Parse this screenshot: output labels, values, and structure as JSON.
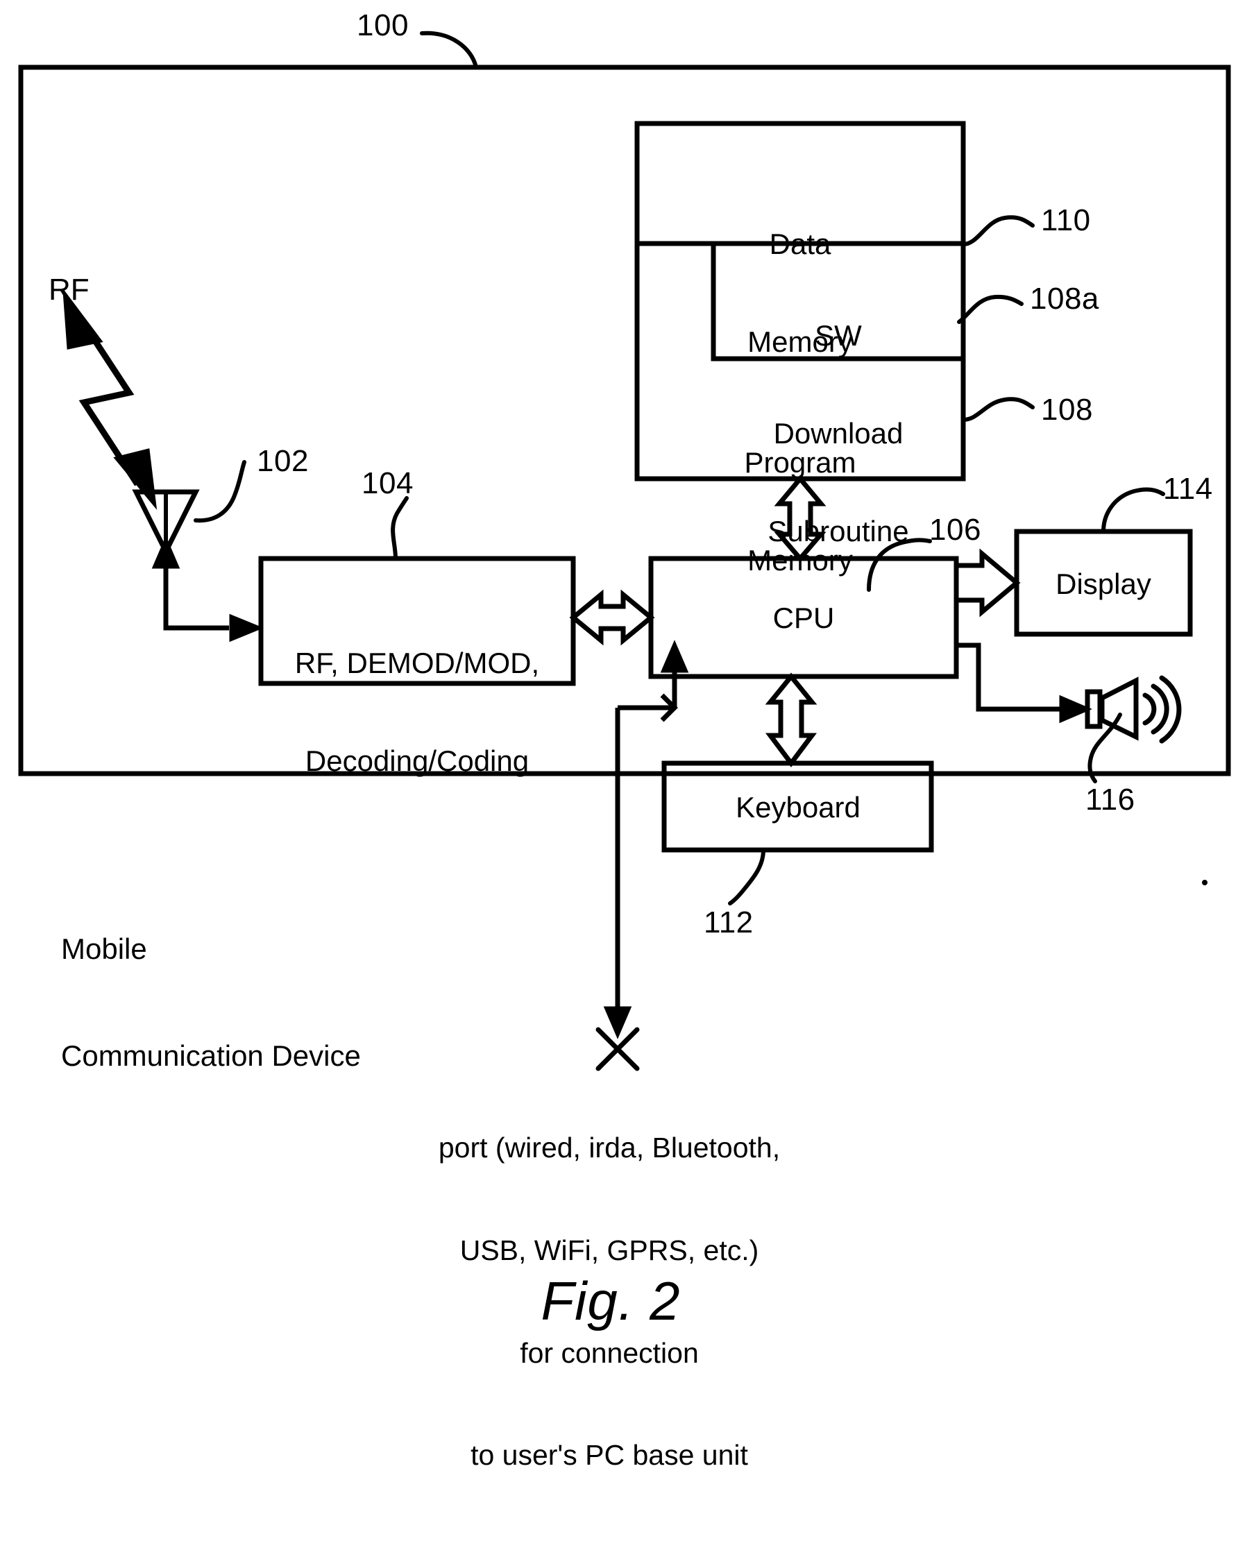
{
  "figure": {
    "caption": "Fig. 2",
    "outer_ref": "100",
    "device_label_line1": "Mobile",
    "device_label_line2": "Communication Device",
    "rf_label": "RF"
  },
  "blocks": {
    "data_memory": {
      "line1": "Data",
      "line2": "Memory",
      "ref": "110"
    },
    "sw_download": {
      "line1": "SW",
      "line2": "Download",
      "line3": "Subroutine",
      "ref": "108a"
    },
    "program_memory": {
      "line1": "Program",
      "line2": "Memory",
      "ref": "108"
    },
    "rf_demod": {
      "line1": "RF, DEMOD/MOD,",
      "line2": "Decoding/Coding",
      "ref": "104"
    },
    "cpu": {
      "label": "CPU",
      "ref": "106"
    },
    "display": {
      "label": "Display",
      "ref": "114"
    },
    "keyboard": {
      "label": "Keyboard",
      "ref": "112"
    },
    "speaker": {
      "ref": "116"
    },
    "antenna": {
      "ref": "102"
    }
  },
  "port": {
    "line1": "port (wired, irda, Bluetooth,",
    "line2": "USB, WiFi, GPRS, etc.)",
    "line3": "for connection",
    "line4": "to user's PC base unit"
  },
  "colors": {
    "ink": "#000000",
    "paper": "#ffffff"
  }
}
